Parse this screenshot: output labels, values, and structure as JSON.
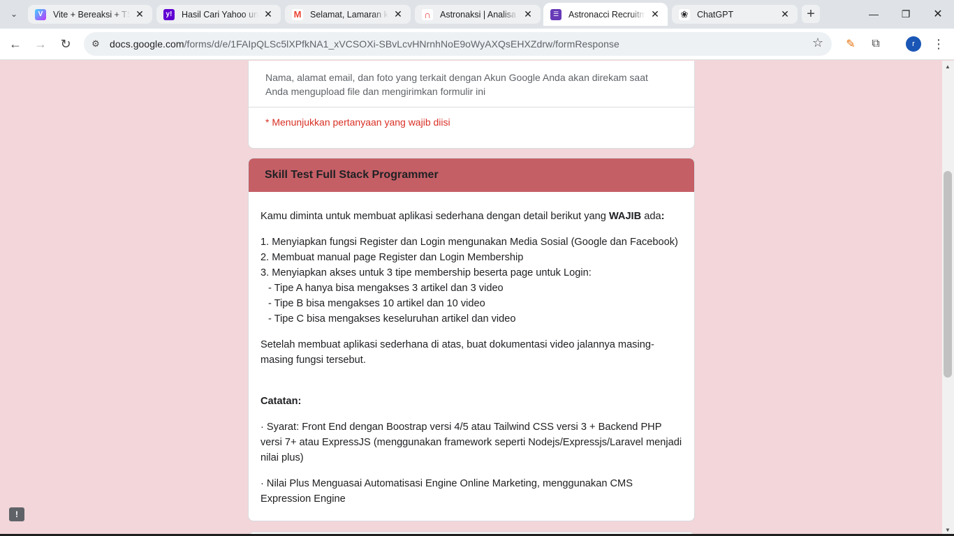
{
  "browser": {
    "tabs": [
      {
        "title": "Vite + Bereaksi + TS",
        "favicon": "vite-icon",
        "color": "#8a5cf6",
        "active": false
      },
      {
        "title": "Hasil Cari Yahoo untuk",
        "favicon": "yahoo-icon",
        "color": "#6001d2",
        "active": false
      },
      {
        "title": "Selamat, Lamaran kerja",
        "favicon": "gmail-icon",
        "color": "#ea4335",
        "active": false
      },
      {
        "title": "Astronaksi | Analisa dan",
        "favicon": "astronacci-icon",
        "color": "#e53935",
        "active": false
      },
      {
        "title": "Astronacci Recruitment",
        "favicon": "forms-icon",
        "color": "#673ab7",
        "active": true
      },
      {
        "title": "ChatGPT",
        "favicon": "chatgpt-icon",
        "color": "#202124",
        "active": false
      }
    ],
    "url_host": "docs.google.com",
    "url_path": "/forms/d/e/1FAIpQLSc5lXPfkNA1_xVCSOXi-SBvLcvHNrnhNoE9oWyAXQsEHXZdrw/formResponse",
    "profile_initial": "r"
  },
  "form": {
    "disclaimer": "Nama, alamat email, dan foto yang terkait dengan Akun Google Anda akan direkam saat Anda mengupload file dan mengirimkan formulir ini",
    "required_note": "* Menunjukkan pertanyaan yang wajib diisi",
    "section_title": "Skill Test Full Stack Programmer",
    "intro_prefix": "Kamu diminta untuk membuat aplikasi sederhana dengan detail berikut yang ",
    "intro_bold": "WAJIB",
    "intro_suffix": " ada",
    "intro_colon": ":",
    "items": [
      "1. Menyiapkan fungsi Register dan Login mengunakan Media Sosial (Google dan Facebook)",
      "2. Membuat manual page Register dan Login Membership",
      "3. Menyiapkan akses untuk 3 tipe membership beserta page untuk Login:"
    ],
    "sub_items": [
      "- Tipe A hanya bisa mengakses 3 artikel dan 3 video",
      "- Tipe B bisa mengakses 10 artikel dan 10 video",
      "- Tipe C bisa mengakses keseluruhan artikel dan video"
    ],
    "after_text": "Setelah membuat aplikasi sederhana di atas, buat dokumentasi video jalannya masing-masing fungsi tersebut.",
    "notes_title": "Catatan:",
    "note_1": "· Syarat: Front End dengan Boostrap versi 4/5 atau Tailwind CSS versi 3 + Backend PHP versi 7+ atau ExpressJS (menggunakan framework seperti Nodejs/Expressjs/Laravel menjadi nilai plus)",
    "note_2": "· Nilai Plus Menguasai Automatisasi Engine Online Marketing, menggunakan CMS Expression Engine"
  },
  "colors": {
    "page_bg": "#f2d6d9",
    "section_header": "#c55f66",
    "required": "#d93025"
  }
}
